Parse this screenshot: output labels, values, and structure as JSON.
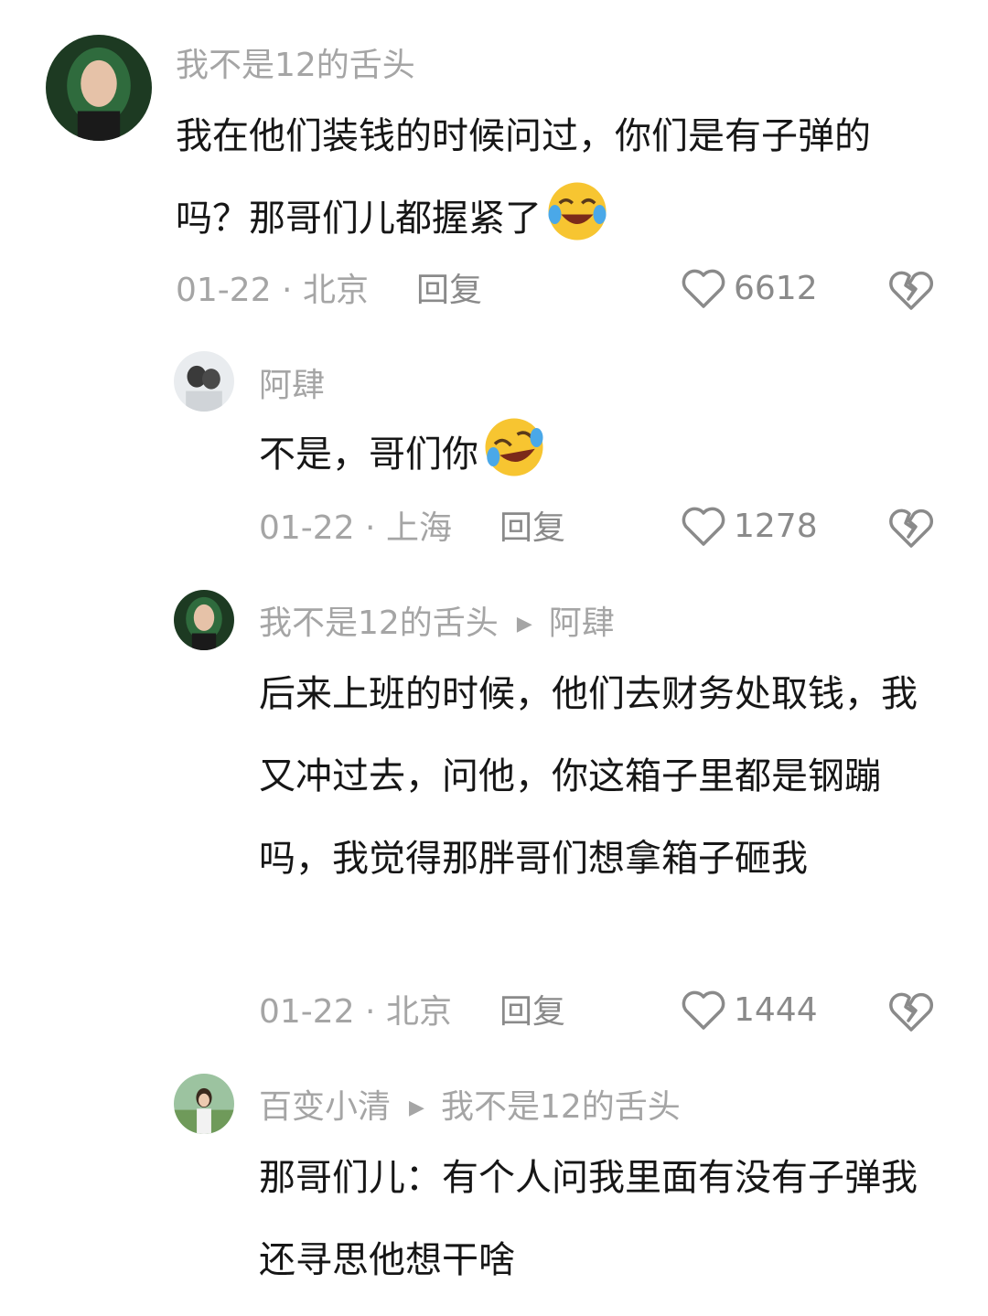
{
  "comments": [
    {
      "username": "我不是12的舌头",
      "text": "我在他们装钱的时候问过，你们是有子弹的吗？那哥们儿都握紧了",
      "emoji": "crying-laughing-emoji",
      "date": "01-22",
      "location": "北京",
      "reply_label": "回复",
      "likes": "6612"
    },
    {
      "username": "阿肆",
      "text": "不是，哥们你",
      "emoji": "rofl-emoji",
      "date": "01-22",
      "location": "上海",
      "reply_label": "回复",
      "likes": "1278"
    },
    {
      "username": "我不是12的舌头",
      "reply_to": "阿肆",
      "text": "后来上班的时候，他们去财务处取钱，我又冲过去，问他，你这箱子里都是钢蹦吗，我觉得那胖哥们想拿箱子砸我",
      "date": "01-22",
      "location": "北京",
      "reply_label": "回复",
      "likes": "1444"
    },
    {
      "username": "百变小清",
      "reply_to": "我不是12的舌头",
      "text": "那哥们儿：有个人问我里面有没有子弹我还寻思他想干啥"
    }
  ],
  "colors": {
    "secondary_text": "#a5a5a5",
    "primary_text": "#161616",
    "icon": "#8a8a8a"
  }
}
